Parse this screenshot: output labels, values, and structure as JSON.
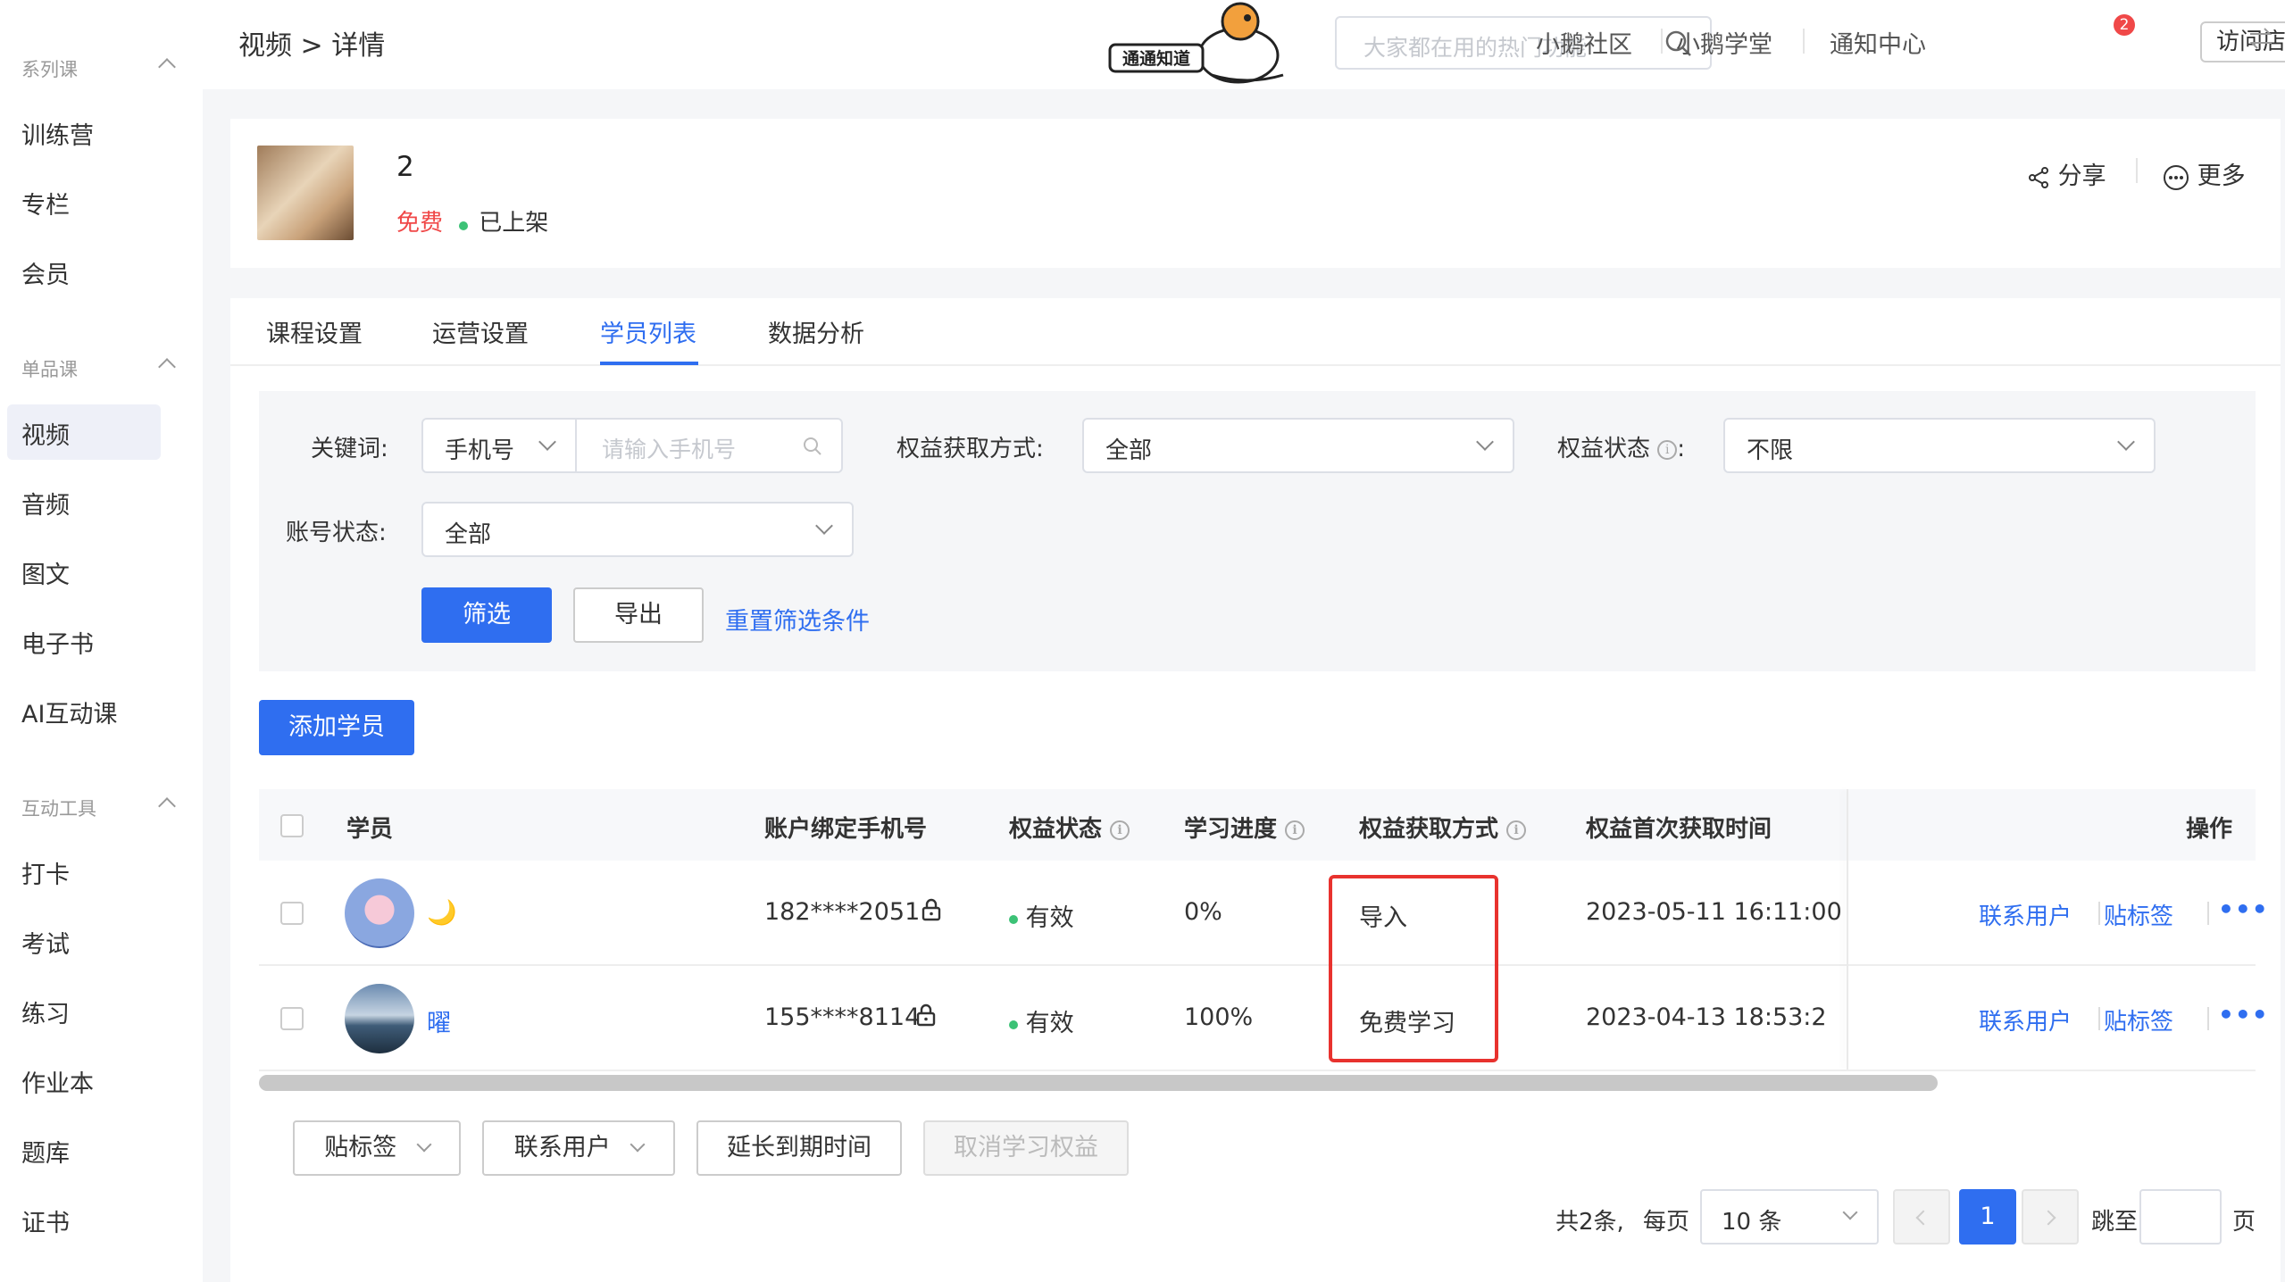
{
  "sidebar": {
    "groups": [
      {
        "label": "系列课",
        "items": [
          "训练营",
          "专栏",
          "会员"
        ]
      },
      {
        "label": "单品课",
        "items": [
          "视频",
          "音频",
          "图文",
          "电子书",
          "AI互动课"
        ]
      },
      {
        "label": "互动工具",
        "items": [
          "打卡",
          "考试",
          "练习",
          "作业本",
          "题库",
          "证书"
        ]
      }
    ],
    "active_item": "视频"
  },
  "header": {
    "breadcrumb": "视频 > 详情",
    "logo_text": "通通知道",
    "search_placeholder": "大家都在用的热门功能",
    "links": [
      "小鹅社区",
      "小鹅学堂",
      "通知中心"
    ],
    "notification_count": "2",
    "visit_store": "访问店铺"
  },
  "course": {
    "title": "2",
    "price": "免费",
    "status": "已上架",
    "share": "分享",
    "more": "更多"
  },
  "tabs": [
    "课程设置",
    "运营设置",
    "学员列表",
    "数据分析"
  ],
  "active_tab": "学员列表",
  "filters": {
    "keyword_label": "关键词:",
    "keyword_type": "手机号",
    "keyword_placeholder": "请输入手机号",
    "acquire_label": "权益获取方式:",
    "acquire_value": "全部",
    "status_label": "权益状态",
    "status_value": "不限",
    "account_label": "账号状态:",
    "account_value": "全部",
    "filter_btn": "筛选",
    "export_btn": "导出",
    "reset_link": "重置筛选条件"
  },
  "add_student": "添加学员",
  "table": {
    "headers": [
      "学员",
      "账户绑定手机号",
      "权益状态",
      "学习进度",
      "权益获取方式",
      "权益首次获取时间",
      "操作"
    ],
    "rows": [
      {
        "name": "🌙",
        "phone": "182****2051",
        "status": "有效",
        "progress": "0%",
        "acquire": "导入",
        "time": "2023-05-11 16:11:00",
        "ops": [
          "联系用户",
          "贴标签",
          "•••"
        ]
      },
      {
        "name": "曜",
        "phone": "155****8114",
        "status": "有效",
        "progress": "100%",
        "acquire": "免费学习",
        "time": "2023-04-13 18:53:2",
        "ops": [
          "联系用户",
          "贴标签",
          "•••"
        ]
      }
    ]
  },
  "bulk_actions": [
    "贴标签",
    "联系用户",
    "延长到期时间",
    "取消学习权益"
  ],
  "pagination": {
    "total": "共2条,",
    "per_page_label": "每页",
    "per_page": "10 条",
    "current": "1",
    "jump_label": "跳至",
    "page_suffix": "页"
  }
}
